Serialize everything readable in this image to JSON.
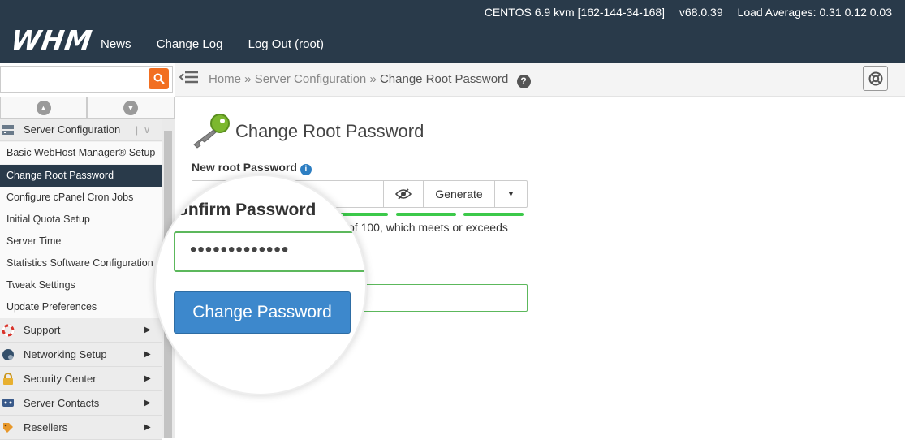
{
  "topbar": {
    "logo": "WHM",
    "sysinfo": {
      "host": "CENTOS 6.9 kvm [162-144-34-168]",
      "version": "v68.0.39",
      "load": "Load Averages: 0.31 0.12 0.03"
    },
    "nav": [
      "News",
      "Change Log",
      "Log Out (root)"
    ]
  },
  "search": {
    "value": "",
    "placeholder": ""
  },
  "breadcrumb": {
    "home": "Home »",
    "section": "Server Configuration »",
    "current": "Change Root Password"
  },
  "sidebar": {
    "group_title": "Server Configuration",
    "items": [
      "Basic WebHost Manager® Setup",
      "Change Root Password",
      "Configure cPanel Cron Jobs",
      "Initial Quota Setup",
      "Server Time",
      "Statistics Software Configuration",
      "Tweak Settings",
      "Update Preferences"
    ],
    "sections": [
      "Support",
      "Networking Setup",
      "Security Center",
      "Server Contacts",
      "Resellers"
    ]
  },
  "page": {
    "title": "Change Root Password",
    "new_label": "New root Password",
    "generate_label": "Generate",
    "strength_text": "of 100, which meets or exceeds",
    "confirm_label": "onfirm Password",
    "confirm_value": "•••••••••••••",
    "submit_label": "Change Password"
  },
  "colors": {
    "topbar": "#293a4a",
    "accent": "#f26f21",
    "primary": "#3d88cc",
    "success": "#3cc94a"
  }
}
